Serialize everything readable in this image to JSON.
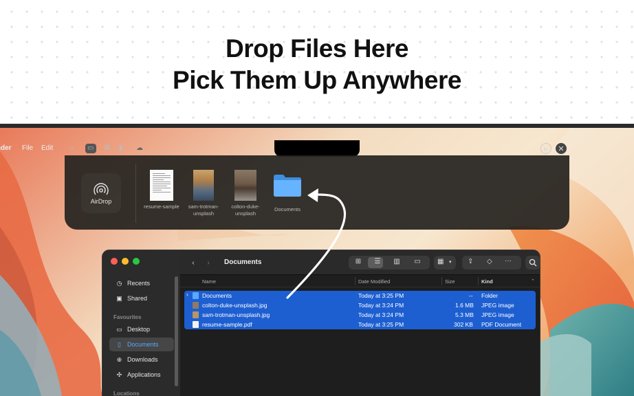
{
  "hero": {
    "line1": "Drop Files Here",
    "line2": "Pick Them Up Anywhere"
  },
  "menubar": {
    "app": "Finder",
    "items": [
      "File",
      "Edit"
    ]
  },
  "tray_icons": [
    "home-icon",
    "tray-icon",
    "gamepad-icon",
    "trash-icon",
    "cloud-icon"
  ],
  "drop_panel": {
    "airdrop_label": "AirDrop",
    "files": [
      {
        "label": "resume-sample",
        "kind": "pdf"
      },
      {
        "label": "sam-trotman-unsplash",
        "kind": "image",
        "colors": [
          "#c8a36b",
          "#4a6a8a"
        ]
      },
      {
        "label": "colton-duke-unsplash",
        "kind": "image",
        "colors": [
          "#6e5a48",
          "#8f8a86"
        ]
      },
      {
        "label": "Documents",
        "kind": "folder"
      }
    ]
  },
  "finder": {
    "title": "Documents",
    "sidebar": {
      "items": [
        {
          "icon": "clock-icon",
          "label": "Recents"
        },
        {
          "icon": "shared-folder-icon",
          "label": "Shared"
        }
      ],
      "favourites_title": "Favourites",
      "favourites": [
        {
          "icon": "desktop-icon",
          "label": "Desktop",
          "active": false
        },
        {
          "icon": "document-icon",
          "label": "Documents",
          "active": true
        },
        {
          "icon": "download-icon",
          "label": "Downloads",
          "active": false
        },
        {
          "icon": "applications-icon",
          "label": "Applications",
          "active": false
        }
      ],
      "locations_title": "Locations"
    },
    "columns": {
      "name": "Name",
      "date": "Date Modified",
      "size": "Size",
      "kind": "Kind"
    },
    "rows": [
      {
        "name": "Documents",
        "date": "Today at 3:25 PM",
        "size": "--",
        "kind": "Folder",
        "icon": "folder-icon",
        "color": "#5aa8ff",
        "disclosure": true
      },
      {
        "name": "colton-duke-unsplash.jpg",
        "date": "Today at 3:24 PM",
        "size": "1.6 MB",
        "kind": "JPEG image",
        "icon": "image-file-icon",
        "color": "#8f7a66",
        "disclosure": false
      },
      {
        "name": "sam-trotman-unsplash.jpg",
        "date": "Today at 3:24 PM",
        "size": "5.3 MB",
        "kind": "JPEG image",
        "icon": "image-file-icon",
        "color": "#b89564",
        "disclosure": false
      },
      {
        "name": "resume-sample.pdf",
        "date": "Today at 3:25 PM",
        "size": "302 KB",
        "kind": "PDF Document",
        "icon": "pdf-file-icon",
        "color": "#f2f2f2",
        "disclosure": false
      }
    ]
  },
  "colors": {
    "accent": "#1d5fd1",
    "folder_blue": "#5aa8ff"
  }
}
